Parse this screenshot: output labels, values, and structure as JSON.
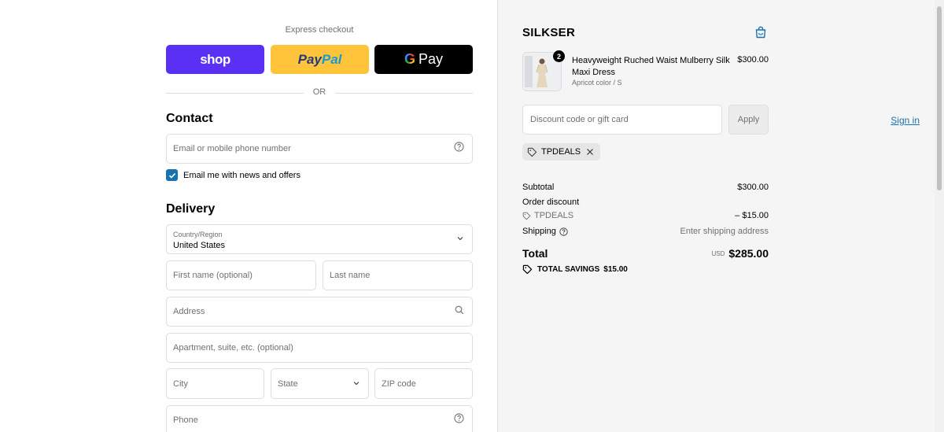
{
  "express": {
    "label": "Express checkout",
    "shop_label": "shop",
    "paypal_part1": "Pay",
    "paypal_part2": "Pal",
    "gpay_g": "G",
    "gpay_label": "Pay",
    "or_text": "OR"
  },
  "contact": {
    "title": "Contact",
    "sign_in": "Sign in",
    "email_placeholder": "Email or mobile phone number",
    "newsletter_label": "Email me with news and offers",
    "newsletter_checked": true
  },
  "delivery": {
    "title": "Delivery",
    "country_label": "Country/Region",
    "country_value": "United States",
    "first_name_placeholder": "First name (optional)",
    "last_name_placeholder": "Last name",
    "address_placeholder": "Address",
    "apartment_placeholder": "Apartment, suite, etc. (optional)",
    "city_placeholder": "City",
    "state_placeholder": "State",
    "zip_placeholder": "ZIP code",
    "phone_placeholder": "Phone"
  },
  "summary": {
    "brand": "SILKSER",
    "product": {
      "name": "Heavyweight Ruched Waist Mulberry Silk Maxi Dress",
      "variant": "Apricot color / S",
      "price": "$300.00",
      "quantity": "2"
    },
    "discount_placeholder": "Discount code or gift card",
    "apply_label": "Apply",
    "applied_code": "TPDEALS",
    "subtotal_label": "Subtotal",
    "subtotal_value": "$300.00",
    "order_discount_label": "Order discount",
    "discount_code": "TPDEALS",
    "discount_value": "– $15.00",
    "shipping_label": "Shipping",
    "shipping_value": "Enter shipping address",
    "total_label": "Total",
    "currency": "USD",
    "total_value": "$285.00",
    "savings_label": "TOTAL SAVINGS",
    "savings_value": "$15.00"
  },
  "colors": {
    "shop_purple": "#5a31f4",
    "paypal_yellow": "#ffc439",
    "link_blue": "#1773b0",
    "summary_bg": "#f5f5f5"
  }
}
